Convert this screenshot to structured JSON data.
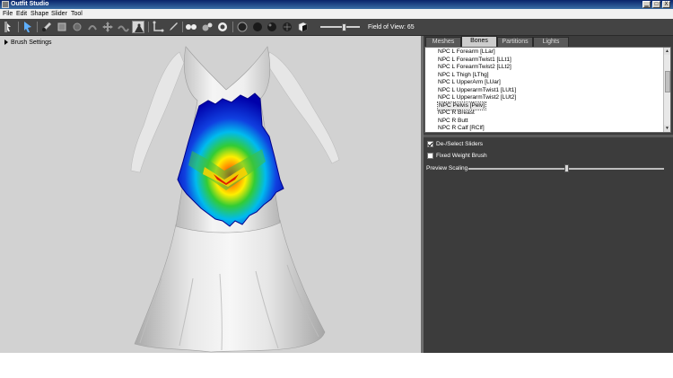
{
  "window": {
    "title": "Outfit Studio",
    "close_glyph": "X"
  },
  "menu": {
    "items": [
      "File",
      "Edit",
      "Shape",
      "Slider",
      "Tool"
    ]
  },
  "toolbar": {
    "field_of_view_label": "Field of View: 65",
    "fov_value": 65,
    "fov_min": 10,
    "fov_max": 100
  },
  "viewport": {
    "brush_settings_label": "Brush Settings"
  },
  "tabs": [
    {
      "label": "Meshes",
      "active": false
    },
    {
      "label": "Bones",
      "active": true
    },
    {
      "label": "Partitions",
      "active": false
    },
    {
      "label": "Lights",
      "active": false
    }
  ],
  "bones": [
    "NPC L Forearm [LLar]",
    "NPC L ForearmTwist1 [LLt1]",
    "NPC L ForearmTwist2 [LLt2]",
    "NPC L Thigh [LThg]",
    "NPC L UpperArm [LUar]",
    "NPC L UpperarmTwist1 [LUt1]",
    "NPC L UpperarmTwist2 [LUt2]",
    "NPC Pelvis [Pelv]",
    "NPC R Breast",
    "NPC R Butt",
    "NPC R Calf [RClf]"
  ],
  "selected_bone": "NPC Pelvis [Pelv]",
  "options": {
    "deselect_sliders_label": "De-/Select Sliders",
    "deselect_sliders_checked": true,
    "fixed_weight_label": "Fixed Weight Brush",
    "fixed_weight_checked": false,
    "preview_scaling_label": "Preview Scaling",
    "preview_scaling_fraction": 0.5
  },
  "colors": {
    "titlebar": "#0a246a",
    "toolbar": "#444444",
    "viewport_bg": "#d2d2d2",
    "panel_bg": "#3c3c3c"
  }
}
